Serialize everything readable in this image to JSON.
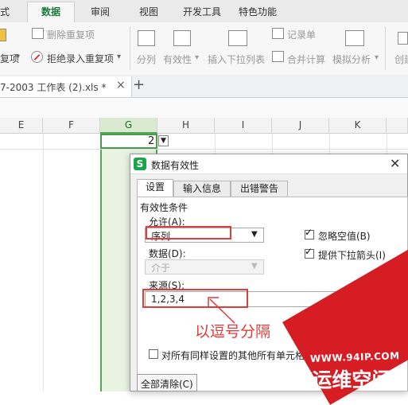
{
  "ribbon_tabs": [
    "式",
    "数据",
    "审阅",
    "视图",
    "开发工具",
    "特色功能"
  ],
  "active_tab": "数据",
  "ribbon": {
    "delete_duplicates": "删除重复项",
    "duplicates_left": "复项",
    "reject_duplicates": "拒绝录入重复项",
    "split": "分列",
    "validity": "有效性",
    "insert_dropdown": "插入下拉列表",
    "record_form": "记录单",
    "consolidate": "合并计算",
    "what_if": "模拟分析",
    "create_partial": "创建"
  },
  "document_tab": "7-2003 工作表 (2).xls *",
  "columns": [
    "E",
    "F",
    "G",
    "H",
    "I",
    "J",
    "K"
  ],
  "selected_column": "G",
  "cell_value": "2",
  "dialog": {
    "title": "数据有效性",
    "tabs": [
      "设置",
      "输入信息",
      "出错警告"
    ],
    "section": "有效性条件",
    "allow_label": "允许(A):",
    "allow_value": "序列",
    "data_label": "数据(D):",
    "data_value": "介于",
    "ignore_blank": "忽略空值(B)",
    "dropdown_arrow": "提供下拉箭头(I)",
    "source_label": "来源(S):",
    "source_value": "1,2,3,4",
    "apply_all": "对所有同样设置的其他所有单元格",
    "clear_all": "全部清除(C)"
  },
  "annotation": "以逗号分隔",
  "watermark": {
    "url": "WWW.94IP.COM",
    "brand": "IT运维空间"
  },
  "colors": {
    "accent": "#1b7a3a",
    "selected_column": "#d9ead0",
    "annotation": "#e23b3b",
    "watermark": "#d71d24"
  }
}
